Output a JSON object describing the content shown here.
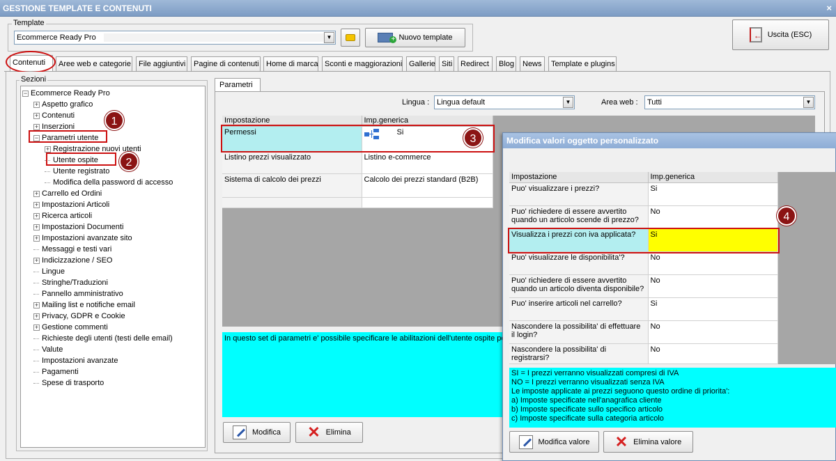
{
  "window": {
    "title": "GESTIONE TEMPLATE E CONTENUTI",
    "close": "×"
  },
  "template": {
    "label": "Template",
    "selected": "Ecommerce Ready Pro",
    "new_button": "Nuovo template",
    "exit_button": "Uscita (ESC)"
  },
  "tabs": [
    "Contenuti",
    "Aree web e categorie",
    "File aggiuntivi",
    "Pagine di contenuti",
    "Home di marca",
    "Sconti e maggiorazioni",
    "Gallerie",
    "Siti",
    "Redirect",
    "Blog",
    "News",
    "Template e plugins"
  ],
  "sections": {
    "label": "Sezioni",
    "root": "Ecommerce Ready Pro",
    "items": [
      "Aspetto grafico",
      "Contenuti",
      "Inserzioni",
      "Parametri utente",
      "Registrazione nuovi utenti",
      "Utente ospite",
      "Utente registrato",
      "Modifica della password di accesso",
      "Carrello ed Ordini",
      "Impostazioni Articoli",
      "Ricerca articoli",
      "Impostazioni Documenti",
      "Impostazioni avanzate sito",
      "Messaggi e testi vari",
      "Indicizzazione / SEO",
      "Lingue",
      "Stringhe/Traduzioni",
      "Pannello amministrativo",
      "Mailing list e notifiche email",
      "Privacy, GDPR e Cookie",
      "Gestione commenti",
      "Richieste degli utenti (testi delle email)",
      "Valute",
      "Impostazioni avanzate",
      "Pagamenti",
      "Spese di trasporto"
    ]
  },
  "params": {
    "tab": "Parametri",
    "lingua_label": "Lingua :",
    "lingua_value": "Lingua default",
    "area_label": "Area web :",
    "area_value": "Tutti",
    "col1": "Impostazione",
    "col2": "Imp.generica",
    "rows": [
      {
        "name": "Permessi",
        "value": "Si"
      },
      {
        "name": "Listino prezzi visualizzato",
        "value": "Listino e-commerce"
      },
      {
        "name": "Sistema di calcolo dei prezzi",
        "value": "Calcolo dei prezzi standard (B2B)"
      }
    ],
    "description": "In questo set di parametri e' possibile specificare le abilitazioni dell'utente ospite per",
    "edit_button": "Modifica",
    "delete_button": "Elimina"
  },
  "dialog": {
    "title": "Modifica valori oggetto personalizzato",
    "col1": "Impostazione",
    "col2": "Imp.generica",
    "rows": [
      {
        "name": "Puo' visualizzare i prezzi?",
        "value": "Si"
      },
      {
        "name": "Puo' richiedere di essere avvertito quando un articolo scende di prezzo?",
        "value": "No"
      },
      {
        "name": "Visualizza i prezzi con iva applicata?",
        "value": "Si"
      },
      {
        "name": "Puo' visualizzare le disponibilita'?",
        "value": "No"
      },
      {
        "name": "Puo' richiedere di essere avvertito quando un articolo diventa disponibile?",
        "value": "No"
      },
      {
        "name": "Puo' inserire articoli nel carrello?",
        "value": "Si"
      },
      {
        "name": "Nascondere la possibilita' di effettuare il login?",
        "value": "No"
      },
      {
        "name": "Nascondere la possibilita' di registrarsi?",
        "value": "No"
      }
    ],
    "help": [
      "SI = I prezzi verranno visualizzati compresi di IVA",
      "NO = I prezzi verranno visualizzati senza IVA",
      "Le imposte applicate ai prezzi seguono questo ordine di priorita':",
      "a) Imposte specificate nell'anagrafica cliente",
      "b) Imposte specificate sullo specifico articolo",
      "c) Imposte specificate sulla categoria articolo"
    ],
    "edit_button": "Modifica valore",
    "delete_button": "Elimina valore"
  },
  "badges": [
    "1",
    "2",
    "3",
    "4"
  ],
  "colors": {
    "accent_red": "#cc1010",
    "cyan": "#00ffff",
    "yellow": "#ffff00",
    "selected_row": "#b3eef0"
  }
}
